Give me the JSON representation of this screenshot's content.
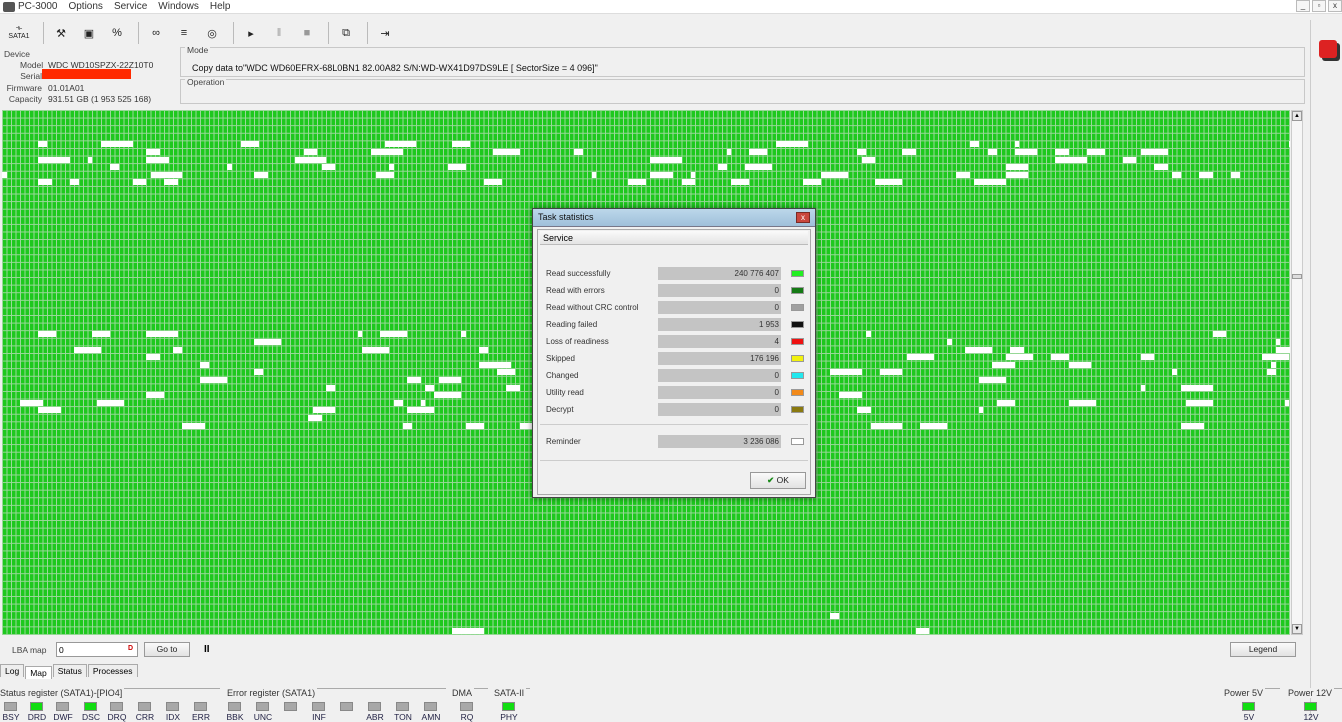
{
  "app": {
    "title": "PC-3000"
  },
  "menu": [
    "Options",
    "Service",
    "Windows",
    "Help"
  ],
  "window_controls": [
    "_",
    "▫",
    "x"
  ],
  "toolbar": {
    "sata_label": "SATA1",
    "buttons": [
      "wrench-icon",
      "disk-info-icon",
      "percent-icon",
      "binoculars-icon",
      "stack-icon",
      "disk-icon",
      "play-icon",
      "pause-icon",
      "stop-icon",
      "copy-icon",
      "exit-icon"
    ]
  },
  "device": {
    "legend": "Device",
    "model_label": "Model",
    "model": "WDC WD10SPZX-22Z10T0",
    "serial_label": "Serial",
    "firmware_label": "Firmware",
    "firmware": "01.01A01",
    "capacity_label": "Capacity",
    "capacity": "931.51 GB (1 953 525 168)"
  },
  "mode": {
    "legend": "Mode",
    "text": "Copy data to\"WDC WD60EFRX-68L0BN1 82.00A82 S/N:WD-WX41D97DS9LE [ SectorSize = 4 096]\""
  },
  "operation": {
    "legend": "Operation"
  },
  "lba": {
    "label": "LBA map",
    "value": "0",
    "goto_label": "Go to",
    "pause_label": "II",
    "legend_label": "Legend"
  },
  "tabs": [
    "Log",
    "Map",
    "Status",
    "Processes"
  ],
  "active_tab": "Map",
  "colors": {
    "map_green": "#1ec81e",
    "led_on": "#11dd11",
    "led_off": "#a8a8a8"
  },
  "registers": {
    "status": {
      "title": "Status register (SATA1)-[PIO4]",
      "leds": [
        {
          "label": "BSY",
          "on": false
        },
        {
          "label": "DRD",
          "on": true
        },
        {
          "label": "DWF",
          "on": false
        },
        {
          "label": "DSC",
          "on": true
        },
        {
          "label": "DRQ",
          "on": false
        },
        {
          "label": "CRR",
          "on": false
        },
        {
          "label": "IDX",
          "on": false
        },
        {
          "label": "ERR",
          "on": false
        }
      ]
    },
    "error": {
      "title": "Error register (SATA1)",
      "leds": [
        {
          "label": "BBK",
          "on": false
        },
        {
          "label": "UNC",
          "on": false
        },
        {
          "label": "",
          "on": false
        },
        {
          "label": "INF",
          "on": false
        },
        {
          "label": "",
          "on": false
        },
        {
          "label": "ABR",
          "on": false
        },
        {
          "label": "TON",
          "on": false
        },
        {
          "label": "AMN",
          "on": false
        }
      ]
    },
    "dma": {
      "title": "DMA",
      "leds": [
        {
          "label": "RQ",
          "on": false
        }
      ]
    },
    "sata": {
      "title": "SATA-II",
      "leds": [
        {
          "label": "PHY",
          "on": true
        }
      ]
    },
    "power5": {
      "title": "Power 5V",
      "leds": [
        {
          "label": "5V",
          "on": true
        }
      ]
    },
    "power12": {
      "title": "Power 12V",
      "leds": [
        {
          "label": "12V",
          "on": true
        }
      ]
    }
  },
  "dialog": {
    "title": "Task statistics",
    "header": "Service",
    "rows": [
      {
        "label": "Read successfully",
        "value": "240 776 407",
        "color": "#22ee22"
      },
      {
        "label": "Read with errors",
        "value": "0",
        "color": "#157a15"
      },
      {
        "label": "Read without CRC control",
        "value": "0",
        "color": "#a0a0a0"
      },
      {
        "label": "Reading failed",
        "value": "1 953",
        "color": "#111111"
      },
      {
        "label": "Loss of readiness",
        "value": "4",
        "color": "#ee1111"
      },
      {
        "label": "Skipped",
        "value": "176 196",
        "color": "#f2f20e"
      },
      {
        "label": "Changed",
        "value": "0",
        "color": "#22e8ee"
      },
      {
        "label": "Utility read",
        "value": "0",
        "color": "#f28a1a"
      },
      {
        "label": "Decrypt",
        "value": "0",
        "color": "#8a7a10"
      }
    ],
    "reminder": {
      "label": "Reminder",
      "value": "3 236 086",
      "color": "#ffffff"
    },
    "ok_label": "OK"
  }
}
